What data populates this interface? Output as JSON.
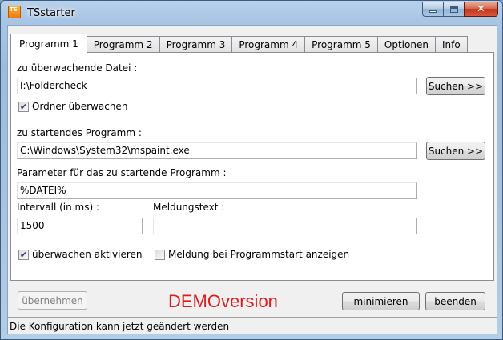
{
  "window": {
    "title": "TSstarter",
    "icon_label": "TS",
    "controls": {
      "minimize": "minimize-icon",
      "maximize": "maximize-icon",
      "close_glyph": "✕"
    }
  },
  "tabs": [
    {
      "label": "Programm 1",
      "active": true
    },
    {
      "label": "Programm 2",
      "active": false
    },
    {
      "label": "Programm 3",
      "active": false
    },
    {
      "label": "Programm 4",
      "active": false
    },
    {
      "label": "Programm 5",
      "active": false
    },
    {
      "label": "Optionen",
      "active": false
    },
    {
      "label": "Info",
      "active": false
    }
  ],
  "form": {
    "file_label": "zu überwachende Datei :",
    "file_value": "I:\\Foldercheck",
    "search_label": "Suchen >>",
    "watch_folder_label": "Ordner überwachen",
    "watch_folder_checked": true,
    "program_label": "zu startendes Programm :",
    "program_value": "C:\\Windows\\System32\\mspaint.exe",
    "params_label": "Parameter für das zu startende Programm :",
    "params_value": "%DATEI%",
    "interval_label": "Intervall (in ms) :",
    "interval_value": "1500",
    "message_label": "Meldungstext :",
    "message_value": "",
    "activate_label": "überwachen aktivieren",
    "activate_checked": true,
    "notify_label": "Meldung bei Programmstart anzeigen",
    "notify_checked": false
  },
  "footer": {
    "apply_label": "übernehmen",
    "demo_text": "DEMOversion",
    "minimize_label": "minimieren",
    "exit_label": "beenden"
  },
  "status": {
    "text": "Die Konfiguration kann jetzt geändert werden"
  },
  "colors": {
    "demo": "#e21c1c",
    "check": "#2b3c6b"
  }
}
